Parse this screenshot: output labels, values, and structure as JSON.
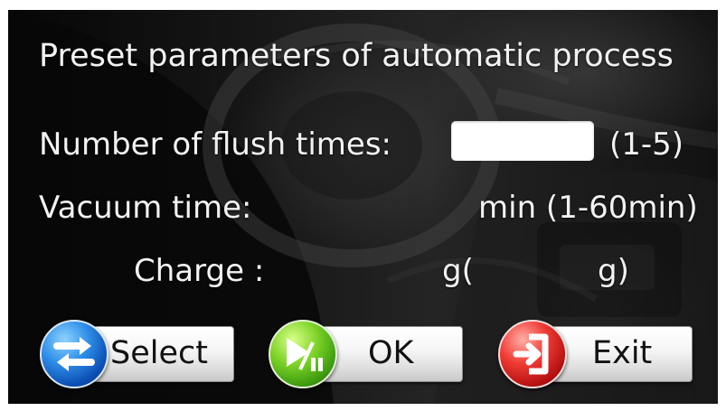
{
  "screen": {
    "title": "Preset parameters of automatic process",
    "background_theme": "dark car dashboard photo"
  },
  "form": {
    "flush": {
      "label": "Number of flush times:",
      "value": "",
      "range": "(1-5)"
    },
    "vacuum": {
      "label": "Vacuum time:",
      "unit_range": "min (1-60min)"
    },
    "charge": {
      "label": "Charge :",
      "unit_open": "g(",
      "unit_close": "g)"
    }
  },
  "buttons": {
    "select": {
      "label": "Select",
      "icon": "swap-arrows-icon",
      "color": "#1f73d8"
    },
    "ok": {
      "label": "OK",
      "icon": "play-pause-icon",
      "color": "#57b91a"
    },
    "exit": {
      "label": "Exit",
      "icon": "exit-door-icon",
      "color": "#d4241f"
    }
  }
}
